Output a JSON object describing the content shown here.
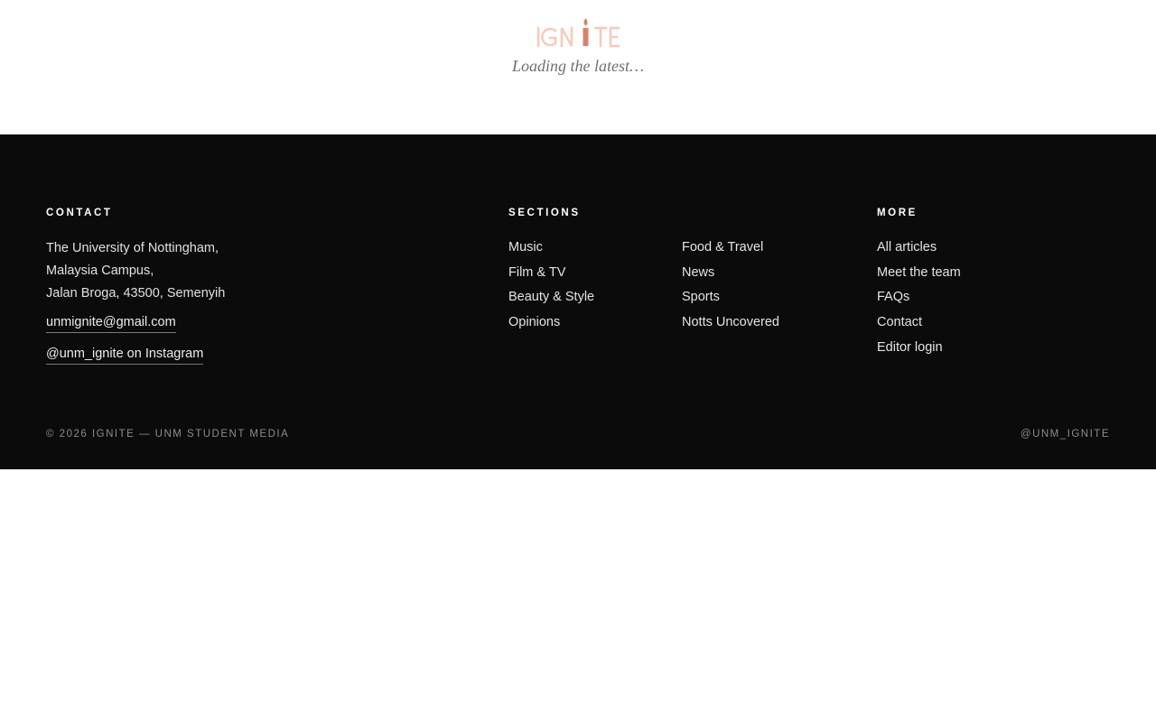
{
  "header": {
    "logo_text": "IGNITE",
    "loading_text": "Loading the latest…"
  },
  "footer": {
    "contact": {
      "heading": "CONTACT",
      "address_lines": [
        "The University of Nottingham,",
        "Malaysia Campus,",
        "Jalan Broga, 43500, Semenyih"
      ],
      "email": "unmignite@gmail.com",
      "instagram": "@unm_ignite on Instagram"
    },
    "sections": {
      "heading": "SECTIONS",
      "col1": [
        "Music",
        "Film & TV",
        "Beauty & Style",
        "Opinions"
      ],
      "col2": [
        "Food & Travel",
        "News",
        "Sports",
        "Notts Uncovered"
      ]
    },
    "more": {
      "heading": "MORE",
      "items": [
        "All articles",
        "Meet the team",
        "FAQs",
        "Contact",
        "Editor login"
      ]
    },
    "copyright": "© 2026 IGNITE — UNM STUDENT MEDIA",
    "handle": "@UNM_IGNITE"
  },
  "colors": {
    "brand_accent": "#d9826a",
    "footer_bg": "#0b0b0b"
  }
}
